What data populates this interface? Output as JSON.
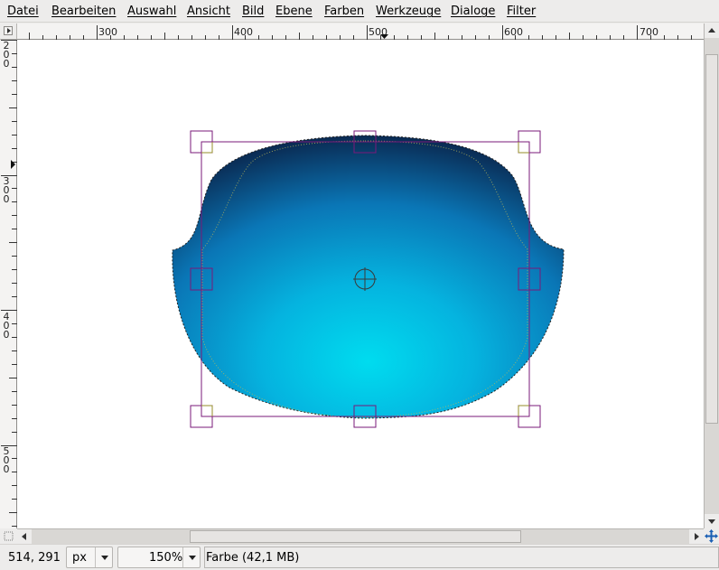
{
  "menubar": {
    "items": [
      "Datei",
      "Bearbeiten",
      "Auswahl",
      "Ansicht",
      "Bild",
      "Ebene",
      "Farben",
      "Werkzeuge",
      "Dialoge",
      "Filter"
    ]
  },
  "rulers": {
    "horizontal_labels": [
      "300",
      "400",
      "500",
      "600",
      "700"
    ],
    "vertical_labels": [
      "200",
      "300",
      "400",
      "500"
    ]
  },
  "canvas": {
    "background": "#ffffff",
    "gradient_dark": "#0a2a52",
    "gradient_mid": "#0a7fc0",
    "gradient_light": "#00d8ec",
    "transform_frame_color": "#7a1a7a",
    "handle_inner_color": "#8a8a1a",
    "center_marker": "crosshair-circle-icon"
  },
  "status": {
    "coordinates": "514, 291",
    "unit": "px",
    "zoom": "150%",
    "layer_info": "Farbe (42,1 MB)"
  },
  "icons": {
    "ruler_corner": "menu-arrow-icon",
    "quick_mask": "quick-mask-icon",
    "navigate": "navigate-icon",
    "scroll_up": "arrow-up-icon",
    "scroll_down": "arrow-down-icon",
    "scroll_left": "arrow-left-icon",
    "scroll_right": "arrow-right-icon"
  }
}
